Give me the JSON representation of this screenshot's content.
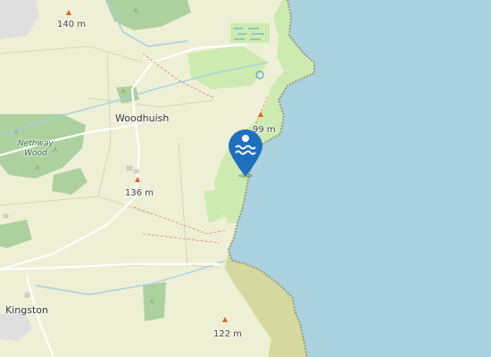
{
  "map": {
    "places": {
      "woodhuish": "Woodhuish",
      "kingston": "Kingston"
    },
    "wood": {
      "line1": "Nethway",
      "line2": "Wood"
    },
    "peaks": {
      "p140": "140 m",
      "p99": "99 m",
      "p136": "136 m",
      "p122": "122 m"
    },
    "marker": {
      "icon": "swimming-icon",
      "color": "#1f6fbf"
    },
    "colors": {
      "sea": "#aad3df",
      "land": "#f2efe9",
      "farmland": "#eef0d5",
      "woodland": "#add19e",
      "grass": "#cdebb0",
      "heath": "#d6d99f",
      "coast_rock": "#c8c8a0"
    }
  }
}
